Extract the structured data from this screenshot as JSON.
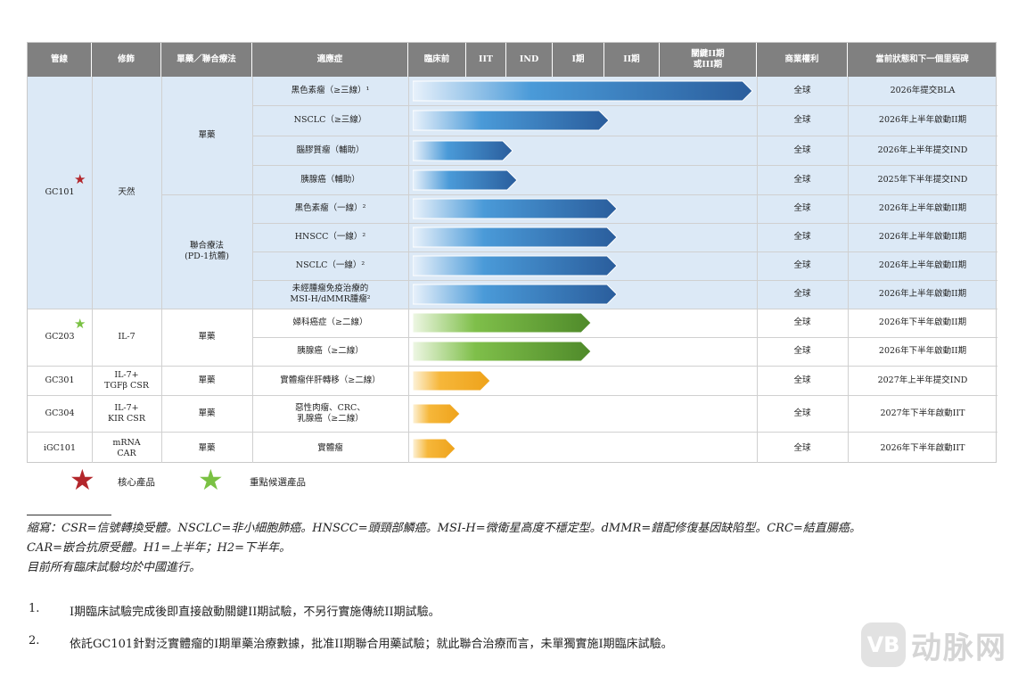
{
  "headers": [
    "管線",
    "修飾",
    "單藥／聯合療法",
    "適應症",
    "臨床前",
    "IIT",
    "IND",
    "I期",
    "II期",
    "關鍵II期\n或III期",
    "商業權利",
    "當前狀態和下一個里程碑"
  ],
  "colors": {
    "header_bg": "#808080",
    "gc101_shade": "#dce9f6",
    "blue_arrow": [
      "#e8f1fb",
      "#4a9ad8",
      "#2a5d9c"
    ],
    "green_arrow": [
      "#eef7e4",
      "#7fbf4a",
      "#4f8a2a"
    ],
    "orange_arrow": [
      "#fdf2d8",
      "#f6b73a",
      "#eea21a"
    ],
    "core_star": "#b3262b",
    "key_star": "#7ac143"
  },
  "groups": [
    {
      "pipeline": "GC101",
      "modification": "天然",
      "star": "core"
    },
    {
      "pipeline": "GC203",
      "modification": "IL-7",
      "star": "key"
    },
    {
      "pipeline": "GC301",
      "modification": "IL-7+\nTGFβ CSR",
      "star": ""
    },
    {
      "pipeline": "GC304",
      "modification": "IL-7+\nKIR CSR",
      "star": ""
    },
    {
      "pipeline": "iGC101",
      "modification": "mRNA\nCAR",
      "star": ""
    }
  ],
  "therapy_labels": [
    "單藥",
    "聯合療法\n(PD-1抗體)",
    "單藥",
    "單藥",
    "單藥",
    "單藥"
  ],
  "rows": [
    {
      "indication": "黑色素瘤（≥三線）¹",
      "progress": 0.78,
      "color": "blue",
      "rights": "全球",
      "status": "2026年提交BLA"
    },
    {
      "indication": "NSCLC（≥三線）",
      "progress": 0.45,
      "color": "blue",
      "rights": "全球",
      "status": "2026年上半年啟動II期"
    },
    {
      "indication": "腦膠質瘤（輔助）",
      "progress": 0.23,
      "color": "blue",
      "rights": "全球",
      "status": "2026年上半年提交IND"
    },
    {
      "indication": "胰腺癌（輔助）",
      "progress": 0.24,
      "color": "blue",
      "rights": "全球",
      "status": "2025年下半年提交IND"
    },
    {
      "indication": "黑色素瘤（一線）²",
      "progress": 0.47,
      "color": "blue",
      "rights": "全球",
      "status": "2026年上半年啟動II期"
    },
    {
      "indication": "HNSCC（一線）²",
      "progress": 0.47,
      "color": "blue",
      "rights": "全球",
      "status": "2026年上半年啟動II期"
    },
    {
      "indication": "NSCLC（一線）²",
      "progress": 0.47,
      "color": "blue",
      "rights": "全球",
      "status": "2026年上半年啟動II期"
    },
    {
      "indication": "未經腫瘤免疫治療的\nMSI-H/dMMR腫瘤²",
      "progress": 0.47,
      "color": "blue",
      "rights": "全球",
      "status": "2026年上半年啟動II期"
    },
    {
      "indication": "婦科癌症（≥二線）",
      "progress": 0.41,
      "color": "green",
      "rights": "全球",
      "status": "2026年下半年啟動II期"
    },
    {
      "indication": "胰腺癌（≥二線）",
      "progress": 0.41,
      "color": "green",
      "rights": "全球",
      "status": "2026年下半年啟動II期"
    },
    {
      "indication": "實體瘤伴肝轉移（≥二線）",
      "progress": 0.18,
      "color": "orange",
      "rights": "全球",
      "status": "2027年上半年提交IND"
    },
    {
      "indication": "惡性肉瘤、CRC、\n乳腺癌（≥二線）",
      "progress": 0.11,
      "color": "orange",
      "rights": "全球",
      "status": "2027年下半年啟動IIT"
    },
    {
      "indication": "實體瘤",
      "progress": 0.1,
      "color": "orange",
      "rights": "全球",
      "status": "2026年下半年啟動IIT"
    }
  ],
  "legend": {
    "core": "核心產品",
    "key": "重點候選產品"
  },
  "abbrev_lines": [
    "縮寫：CSR=信號轉換受體。NSCLC=非小細胞肺癌。HNSCC=頭頸部鱗癌。MSI-H=微衛星高度不穩定型。dMMR=錯配修復基因缺陷型。CRC=結直腸癌。",
    "CAR=嵌合抗原受體。H1=上半年；H2=下半年。",
    "目前所有臨床試驗均於中國進行。"
  ],
  "footnotes": [
    {
      "num": "1.",
      "text": "I期臨床試驗完成後即直接啟動關鍵II期試驗，不另行實施傳統II期試驗。"
    },
    {
      "num": "2.",
      "text": "依託GC101針對泛實體瘤的I期單藥治療數據，批准II期聯合用藥試驗；就此聯合治療而言，未單獨實施I期臨床試驗。"
    }
  ],
  "watermark": {
    "icon": "VB",
    "text": "动脉网"
  }
}
